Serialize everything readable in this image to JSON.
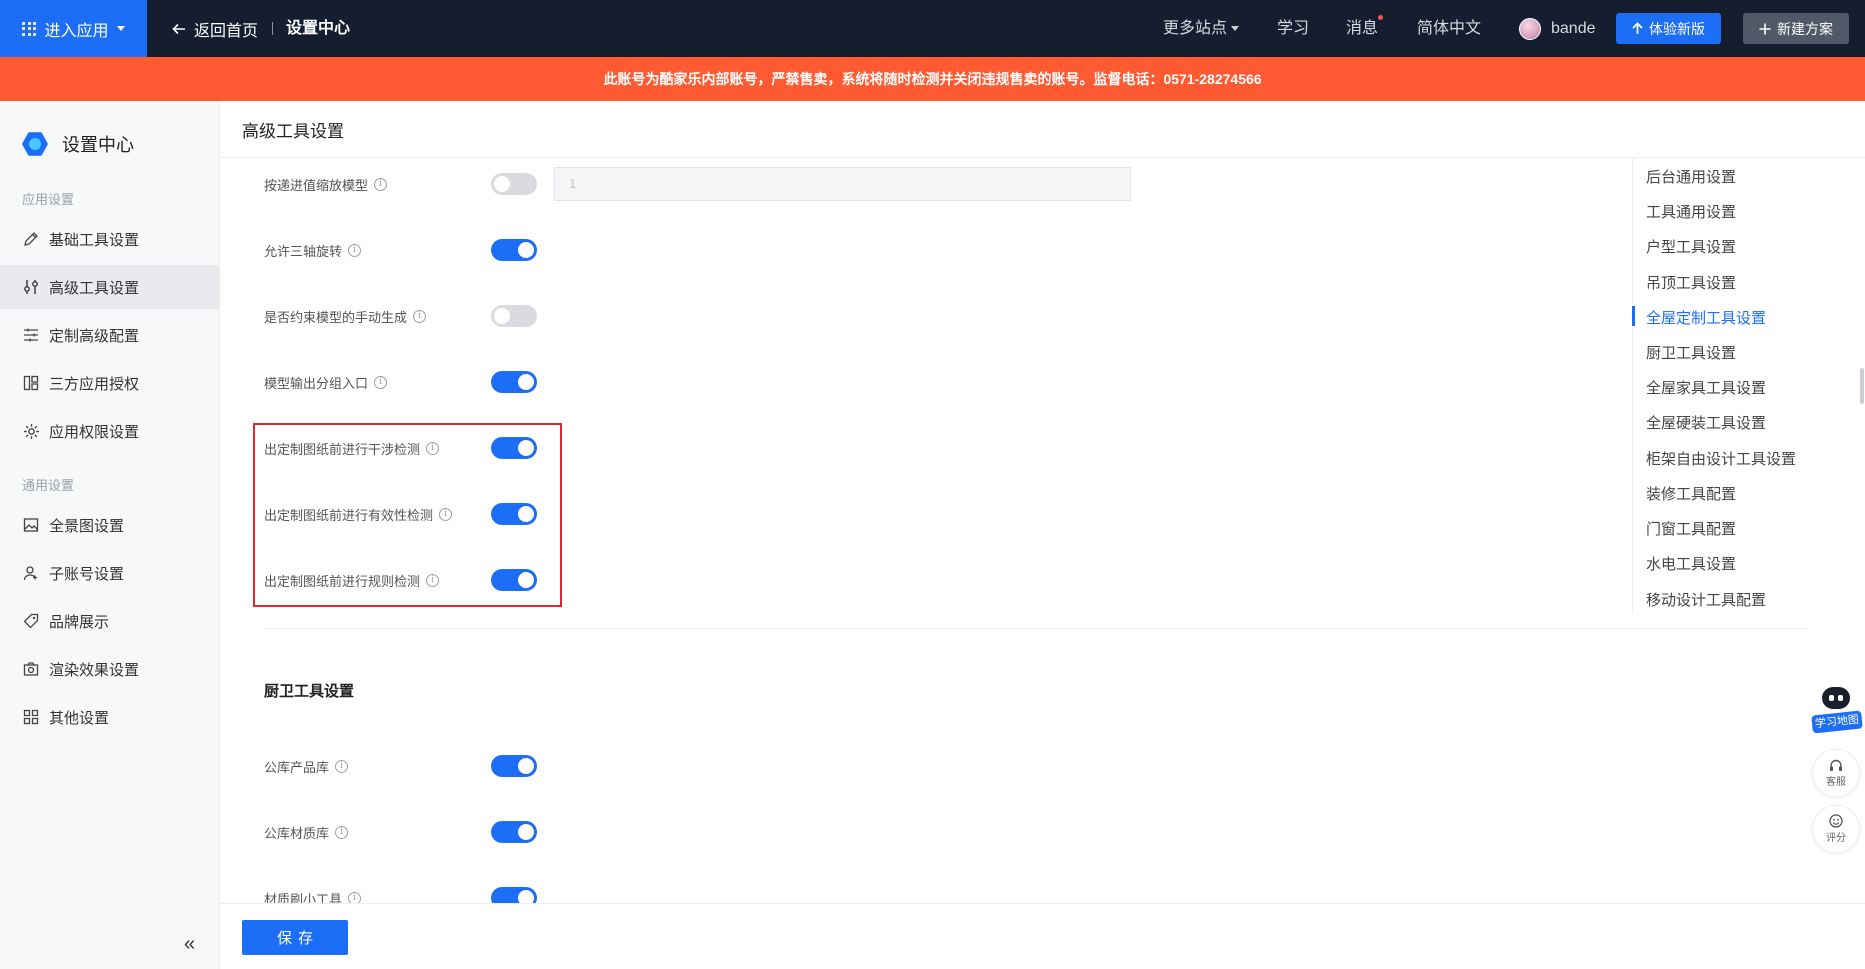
{
  "topbar": {
    "enter_app": "进入应用",
    "back_home": "返回首页",
    "current": "设置中心",
    "more_sites": "更多站点",
    "learn": "学习",
    "messages": "消息",
    "language": "简体中文",
    "username": "bande",
    "try_new": "体验新版",
    "new_plan": "新建方案"
  },
  "banner": "此账号为酷家乐内部账号，严禁售卖，系统将随时检测并关闭违规售卖的账号。监督电话：0571-28274566",
  "sidebar": {
    "title": "设置中心",
    "group_app": "应用设置",
    "group_general": "通用设置",
    "items": [
      {
        "label": "基础工具设置",
        "icon": "pencil-icon"
      },
      {
        "label": "高级工具设置",
        "icon": "sliders-icon"
      },
      {
        "label": "定制高级配置",
        "icon": "list-settings-icon"
      },
      {
        "label": "三方应用授权",
        "icon": "layout-icon"
      },
      {
        "label": "应用权限设置",
        "icon": "gear-icon"
      },
      {
        "label": "全景图设置",
        "icon": "image-icon"
      },
      {
        "label": "子账号设置",
        "icon": "user-icon"
      },
      {
        "label": "品牌展示",
        "icon": "tag-icon"
      },
      {
        "label": "渲染效果设置",
        "icon": "camera-icon"
      },
      {
        "label": "其他设置",
        "icon": "grid-icon"
      }
    ],
    "collapse": "«"
  },
  "main": {
    "title": "高级工具设置",
    "settings": [
      {
        "label": "按递进值缩放模型",
        "enabled": false
      },
      {
        "label": "允许三轴旋转",
        "enabled": true
      },
      {
        "label": "是否约束模型的手动生成",
        "enabled": false
      },
      {
        "label": "模型输出分组入口",
        "enabled": true
      },
      {
        "label": "出定制图纸前进行干涉检测",
        "enabled": true
      },
      {
        "label": "出定制图纸前进行有效性检测",
        "enabled": true
      },
      {
        "label": "出定制图纸前进行规则检测",
        "enabled": true
      }
    ],
    "step_value": "1",
    "section_title": "厨卫工具设置",
    "section_settings": [
      {
        "label": "公库产品库",
        "enabled": true
      },
      {
        "label": "公库材质库",
        "enabled": true
      },
      {
        "label": "材质刷小工具",
        "enabled": true
      }
    ]
  },
  "anchor_nav": [
    "后台通用设置",
    "工具通用设置",
    "户型工具设置",
    "吊顶工具设置",
    "全屋定制工具设置",
    "厨卫工具设置",
    "全屋家具工具设置",
    "全屋硬装工具设置",
    "柜架自由设计工具设置",
    "装修工具配置",
    "门窗工具配置",
    "水电工具设置",
    "移动设计工具配置"
  ],
  "anchor_active": "全屋定制工具设置",
  "float": {
    "learn_map": "学习地图",
    "service": "客服",
    "rate": "评分"
  },
  "footer": {
    "save": "保存"
  },
  "colors": {
    "primary": "#1d6ef7",
    "banner": "#ff5a32",
    "topbar": "#141e2e",
    "highlight": "#e0282e"
  }
}
